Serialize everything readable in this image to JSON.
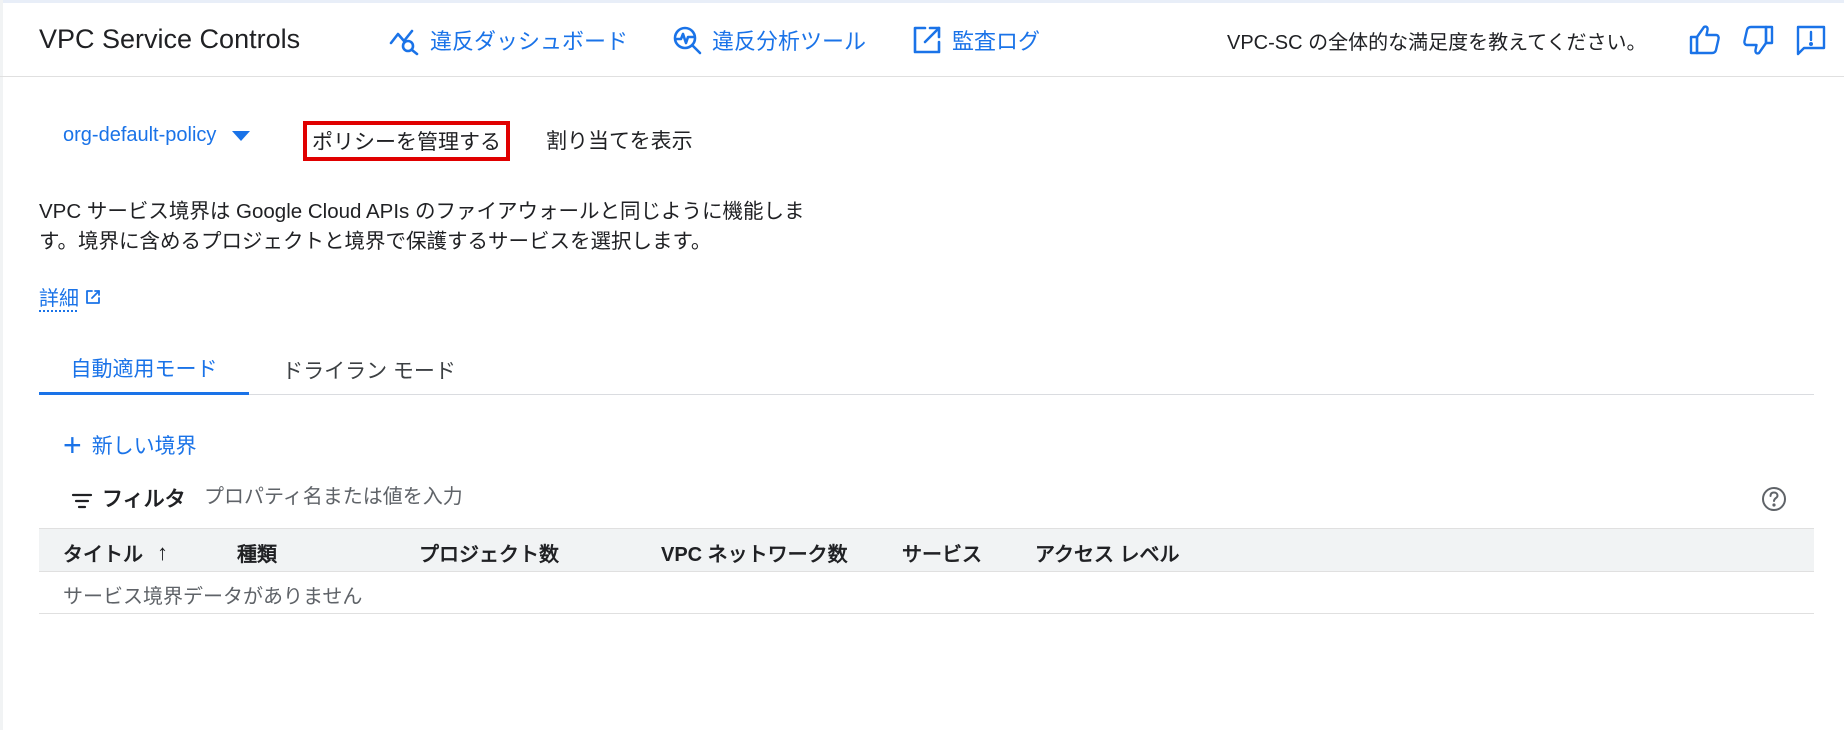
{
  "header": {
    "title": "VPC Service Controls",
    "links": {
      "dashboard": "違反ダッシュボード",
      "analysis": "違反分析ツール",
      "audit": "監査ログ"
    },
    "feedback_prompt": "VPC-SC の全体的な満足度を教えてください。",
    "icons": [
      "thumb-up-icon",
      "thumb-down-icon",
      "feedback-icon"
    ]
  },
  "policy": {
    "selected": "org-default-policy",
    "manage_label": "ポリシーを管理する",
    "assign_label": "割り当てを表示"
  },
  "description": {
    "text": "VPC サービス境界は Google Cloud APIs のファイアウォールと同じように機能します。境界に含めるプロジェクトと境界で保護するサービスを選択します。",
    "learn_more": "詳細"
  },
  "tabs": [
    {
      "label": "自動適用モード",
      "active": true
    },
    {
      "label": "ドライラン モード",
      "active": false
    }
  ],
  "actions": {
    "new_perimeter": "新しい境界"
  },
  "filter": {
    "label": "フィルタ",
    "placeholder": "プロパティ名または値を入力"
  },
  "table": {
    "columns": [
      "タイトル",
      "種類",
      "プロジェクト数",
      "VPC ネットワーク数",
      "サービス",
      "アクセス レベル"
    ],
    "sort_indicator": "↑",
    "empty_message": "サービス境界データがありません"
  },
  "colors": {
    "accent": "#1a73e8",
    "highlight_border": "#e00000"
  }
}
